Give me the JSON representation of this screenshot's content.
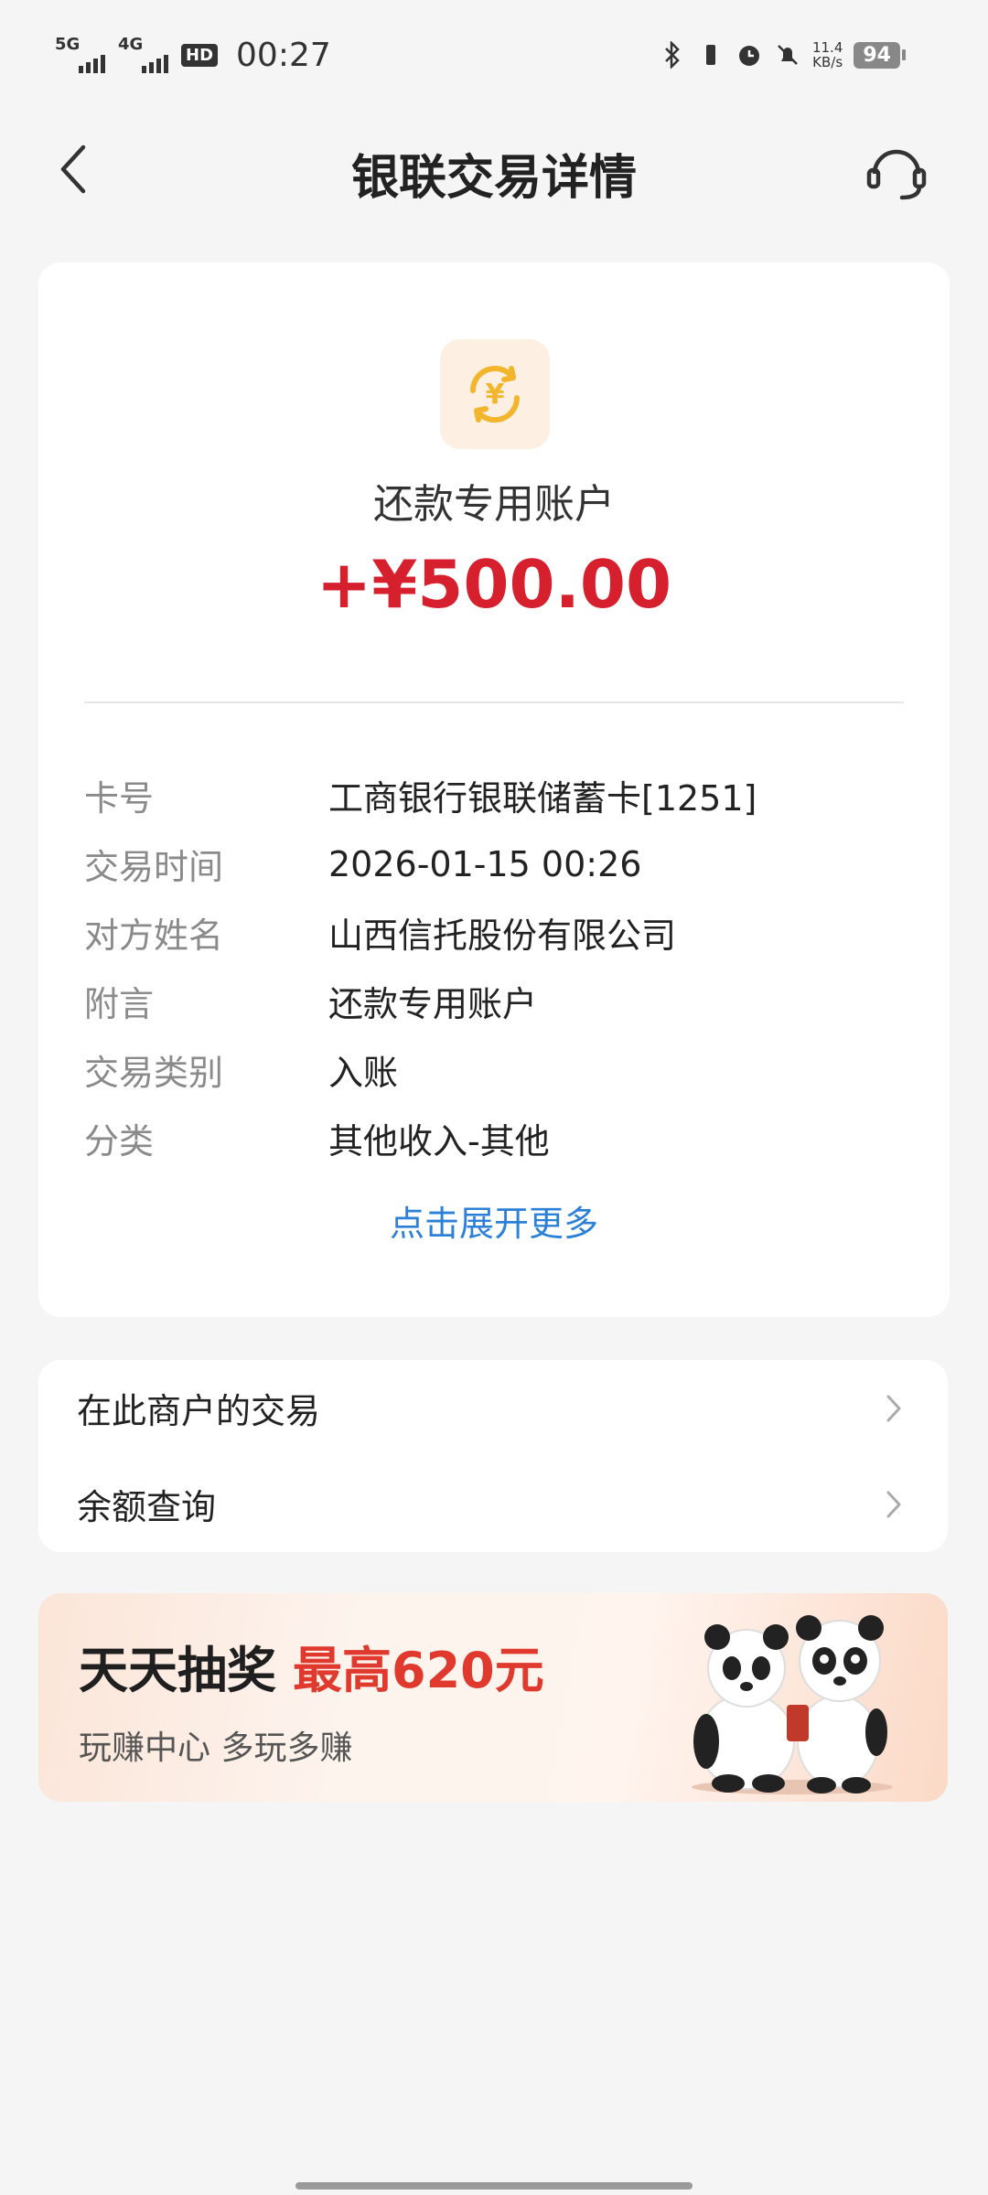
{
  "status_bar": {
    "net1": "5G",
    "net2": "4G",
    "hd": "HD",
    "time": "00:27",
    "speed_value": "11.4",
    "speed_unit": "KB/s",
    "battery": "94"
  },
  "header": {
    "title": "银联交易详情"
  },
  "transaction": {
    "account_name": "还款专用账户",
    "amount": "+¥500.00",
    "details": [
      {
        "label": "卡号",
        "value": "工商银行银联储蓄卡[1251]"
      },
      {
        "label": "交易时间",
        "value": "2026-01-15 00:26"
      },
      {
        "label": "对方姓名",
        "value": "山西信托股份有限公司"
      },
      {
        "label": "附言",
        "value": "还款专用账户"
      },
      {
        "label": "交易类别",
        "value": "入账"
      },
      {
        "label": "分类",
        "value": "其他收入-其他"
      }
    ],
    "expand_label": "点击展开更多"
  },
  "links": [
    {
      "label": "在此商户的交易"
    },
    {
      "label": "余额查询"
    }
  ],
  "promo": {
    "title": "天天抽奖",
    "highlight": "最高620元",
    "subtitle": "玩赚中心  多玩多赚"
  },
  "colors": {
    "amount": "#d6202e",
    "link": "#2c80d8",
    "icon_bg": "#fdf0e2",
    "icon_fg": "#f2b52c",
    "promo_highlight": "#e03a2f"
  }
}
